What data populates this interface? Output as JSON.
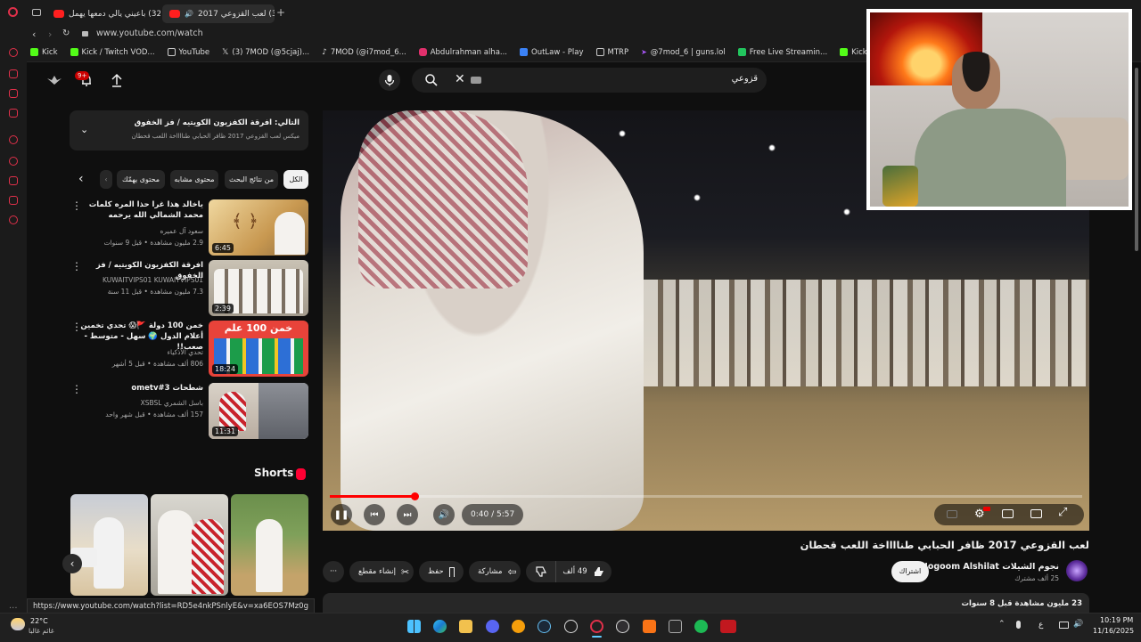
{
  "browser": {
    "tabs": [
      {
        "label": "(32) باعيني يالي دمعها يهمل",
        "active": false
      },
      {
        "label": "(32) لعب القزوعي 2017",
        "active": true
      }
    ],
    "new_tab": "+",
    "url": "www.youtube.com/watch",
    "bookmarks": [
      {
        "label": "Kick",
        "color": "#53fc18"
      },
      {
        "label": "Kick / Twitch VOD...",
        "color": "#53fc18"
      },
      {
        "label": "YouTube",
        "color": "#ffffff"
      },
      {
        "label": "(3) 7MOD (@5cjaj)...",
        "color": "#ffffff"
      },
      {
        "label": "7MOD (@i7mod_6...",
        "color": "#ffffff"
      },
      {
        "label": "Abdulrahman alha...",
        "color": "#e1306c"
      },
      {
        "label": "OutLaw - Play",
        "color": "#3b82f6"
      },
      {
        "label": "MTRP",
        "color": "#ffffff"
      },
      {
        "label": "@7mod_6 | guns.lol",
        "color": "#a855f7"
      },
      {
        "label": "Free Live Streamin...",
        "color": "#22c55e"
      },
      {
        "label": "KickBot Saved Wi...",
        "color": "#53fc18"
      }
    ]
  },
  "header": {
    "notif_badge": "9+",
    "search_value": "قزوعي"
  },
  "mix": {
    "title": "التالي: افرقة الكفزيون الكويتيه / فز الخفوق",
    "subtitle": "ميكس لعب القزوعي 2017 ظافر الحبابي طنااااخة اللعب قحطان"
  },
  "chips": [
    "الكل",
    "من نتائج البحث",
    "محتوى مشابه",
    "محتوى يهمّك"
  ],
  "recs": [
    {
      "title": "ياخالد هذا غرا حذا المره كلمات محمد الشمالي الله يرحمه",
      "channel": "سعود آل عميره",
      "meta": "2.9 مليون مشاهدة • قبل 9 سنوات",
      "duration": "6:45",
      "thumb_color": "#d8b070"
    },
    {
      "title": "افرقة الكفزيون الكويتيه / فز الخفوق",
      "channel": "KUWAITVIPS01 KUWAITVIPS01",
      "meta": "7.3 مليون مشاهدة • قبل 11 سنة",
      "duration": "2:39",
      "thumb_color": "#c8beb0"
    },
    {
      "title": "خمن 100 دولة 🚩😱 تحدي تخمين أعلام الدول 🌍 سهل - متوسط - صعب!!",
      "channel": "تحدي الأذكياء",
      "meta": "806 ألف مشاهدة • قبل 5 أشهر",
      "duration": "18:24",
      "thumb_color": "#e8433a",
      "thumb_text": "خمن 100 علم"
    },
    {
      "title": "شطحات ometv#3",
      "channel": "باسل الشمري XSBSL",
      "meta": "157 ألف مشاهدة • قبل شهر واحد",
      "duration": "11:31",
      "thumb_color": "#8a8c90"
    }
  ],
  "shorts": {
    "label": "Shorts"
  },
  "player": {
    "time": "0:40 / 5:57",
    "progress": 0.112
  },
  "video": {
    "title": "لعب القزوعي 2017 ظافر الحبابي طنااااخة اللعب قحطان",
    "channel": "Nogoom Alshilat نجوم الشيلات",
    "subs": "25 ألف مشترك",
    "subscribe": "اشتراك",
    "likes": "49 ألف",
    "share": "مشاركة",
    "save": "حفظ",
    "clip": "إنشاء مقطع",
    "views": "23 مليون مشاهدة قبل 8 سنوات"
  },
  "status_url": "https://www.youtube.com/watch?list=RD5e4nkPSnlyE&v=xa6EOS7Mz0g",
  "taskbar": {
    "weather_temp": "22°C",
    "weather_desc": "غائم غالبا",
    "lang": "ع",
    "time": "10:19 PM",
    "date": "11/16/2025"
  },
  "facecam_label": ""
}
